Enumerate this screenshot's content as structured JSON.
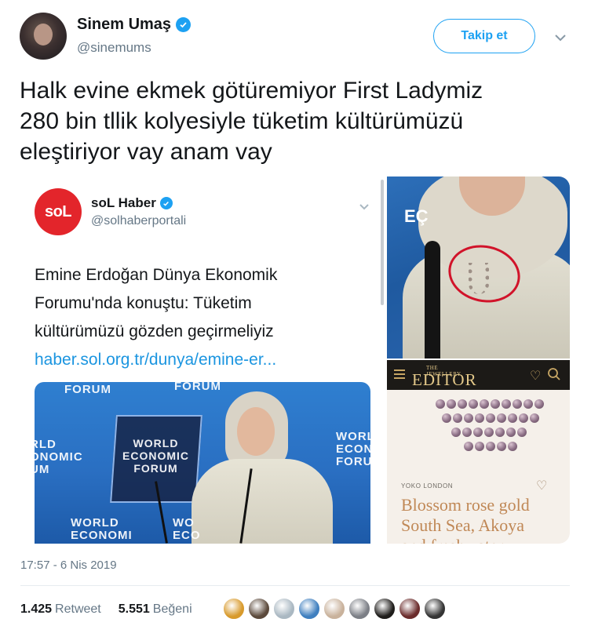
{
  "author": {
    "name": "Sinem Umaş",
    "handle": "@sinemums",
    "avatar_icon": "user-avatar",
    "verified_icon": "verified-badge-icon"
  },
  "follow_button": {
    "label": "Takip et"
  },
  "tweet": {
    "text": "Halk evine ekmek götüremiyor First Ladymiz\n280 bin tllik kolyesiyle tüketim kültürümüzü\neleştiriyor vay anam vay"
  },
  "quoted": {
    "logo_text": "soL",
    "name": "soL Haber",
    "handle": "@solhaberportali",
    "text": "Emine Erdoğan Dünya Ekonomik\nForumu'nda konuştu: Tüketim\nkültürümüzü gözden geçirmeliyiz",
    "link": "haber.sol.org.tr/dunya/emine-er...",
    "photo_texts": {
      "forum_top_left": "FORUM",
      "forum_top_mid": "FORUM",
      "podium": "WORLD\nECONOMIC\nFORUM",
      "left_side": "RLD\nONOMIC\nUM",
      "right_side": "WORL\nECONO\nFORU",
      "bottom_left": "WORLD\nECONOMI",
      "bottom_mid": "WO\nECO"
    }
  },
  "right_top_photo": {
    "text": "EÇ"
  },
  "jewellery_site": {
    "logo_small": "THE JEWELLERY",
    "logo_main": "EDITOR",
    "brand": "YOKO LONDON",
    "product_title": "Blossom rose gold\nSouth Sea, Akoya\nand freshwater"
  },
  "meta": {
    "timestamp": "17:57 - 6 Nis 2019",
    "retweets": "1.425",
    "retweet_label": "Retweet",
    "likes": "5.551",
    "like_label": "Beğeni"
  },
  "liker_colors": [
    "#d89a2c",
    "#5c4a3c",
    "#aab8c2",
    "#3f7fbf",
    "#c9b29c",
    "#7c7f86",
    "#1f1d1b",
    "#6b2c2c",
    "#343434"
  ],
  "colors": {
    "accent": "#1da1f2",
    "link": "#1b95e0",
    "muted": "#657786",
    "sol_red": "#e3252b",
    "highlight_circle": "#d1132a"
  }
}
